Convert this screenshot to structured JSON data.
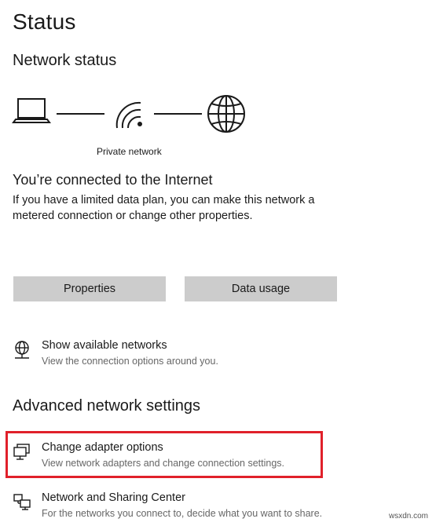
{
  "page": {
    "title": "Status"
  },
  "network_status": {
    "heading": "Network status",
    "network_label": "Private network",
    "icons": [
      "laptop-icon",
      "wifi-icon",
      "globe-icon"
    ]
  },
  "connection": {
    "heading": "You’re connected to the Internet",
    "description": "If you have a limited data plan, you can make this network a metered connection or change other properties."
  },
  "buttons": {
    "properties": "Properties",
    "data_usage": "Data usage"
  },
  "show_networks": {
    "title": "Show available networks",
    "subtitle": "View the connection options around you.",
    "icon": "globe-network-icon"
  },
  "advanced": {
    "heading": "Advanced network settings",
    "items": [
      {
        "title": "Change adapter options",
        "subtitle": "View network adapters and change connection settings.",
        "icon": "adapter-icon",
        "highlighted": true
      },
      {
        "title": "Network and Sharing Center",
        "subtitle": "For the networks you connect to, decide what you want to share.",
        "icon": "sharing-center-icon",
        "highlighted": false
      }
    ]
  },
  "colors": {
    "button_bg": "#cccccc",
    "highlight": "#e0202a",
    "subtext": "#666666"
  },
  "watermark": "wsxdn.com"
}
